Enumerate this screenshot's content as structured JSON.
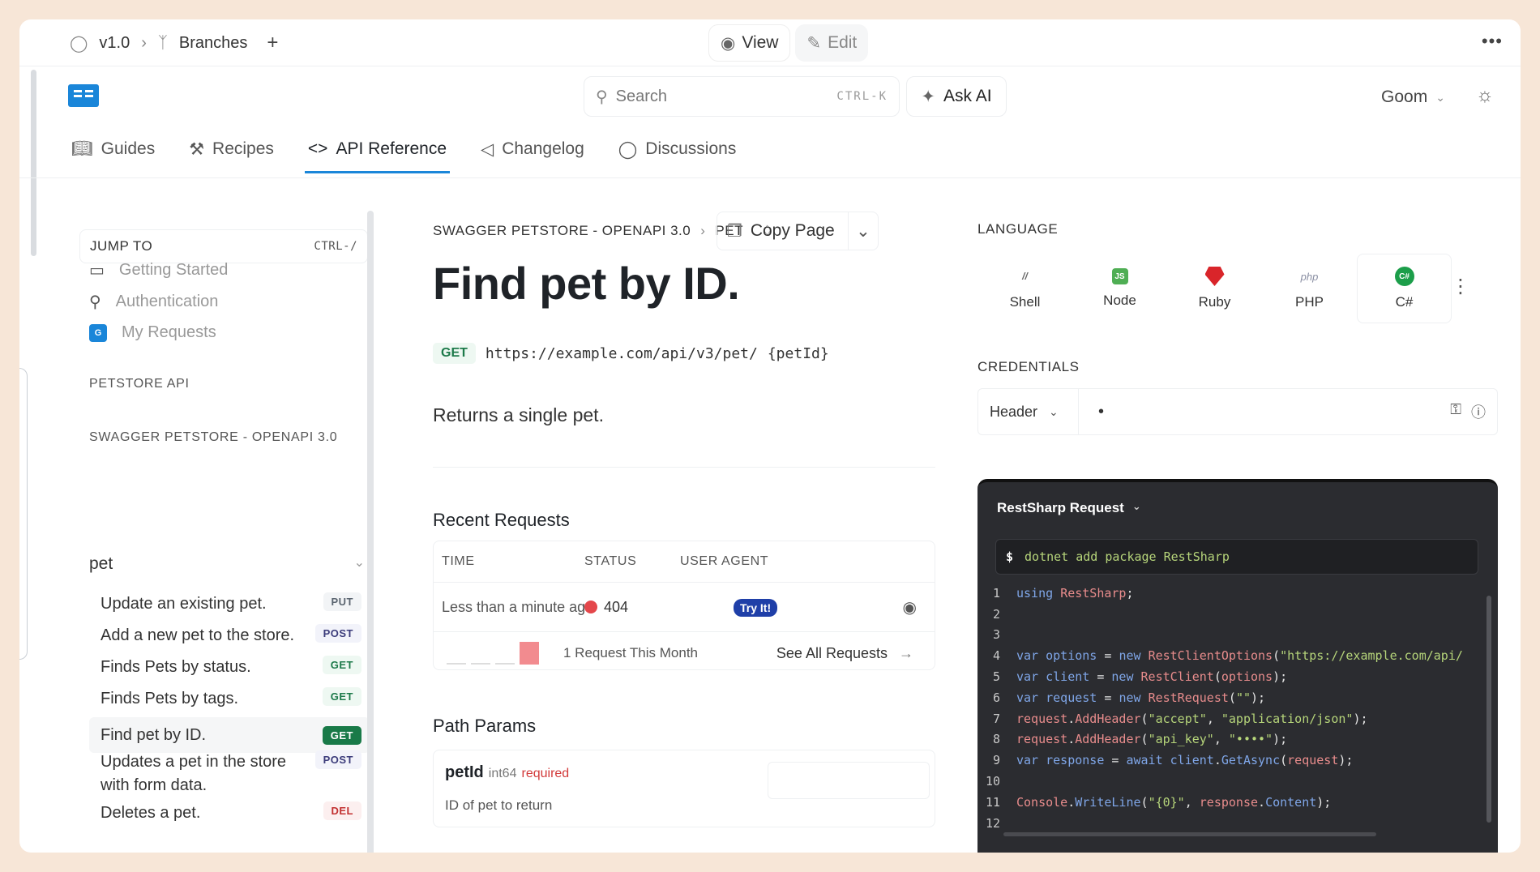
{
  "topbar": {
    "version": "v1.0",
    "branches": "Branches",
    "add": "+",
    "view": "View",
    "edit": "Edit",
    "more": "•••"
  },
  "header": {
    "search_placeholder": "Search",
    "search_kbd": "CTRL-K",
    "ask_ai": "Ask AI",
    "user": "Goom"
  },
  "nav": {
    "tabs": [
      {
        "label": "Guides",
        "icon": "book-icon"
      },
      {
        "label": "Recipes",
        "icon": "flask-icon"
      },
      {
        "label": "API Reference",
        "icon": "code-icon"
      },
      {
        "label": "Changelog",
        "icon": "megaphone-icon"
      },
      {
        "label": "Discussions",
        "icon": "chat-icon"
      }
    ]
  },
  "sidebar": {
    "jump_label": "JUMP TO",
    "jump_kbd": "CTRL-/",
    "top_items": [
      {
        "label": "Getting Started"
      },
      {
        "label": "Authentication"
      },
      {
        "label": "My Requests",
        "badge": "G"
      }
    ],
    "section1": "PETSTORE API",
    "section2": "SWAGGER PETSTORE - OPENAPI 3.0",
    "group": "pet",
    "ops": [
      {
        "label": "Update an existing pet.",
        "method": "PUT"
      },
      {
        "label": "Add a new pet to the store.",
        "method": "POST"
      },
      {
        "label": "Finds Pets by status.",
        "method": "GET"
      },
      {
        "label": "Finds Pets by tags.",
        "method": "GET"
      },
      {
        "label": "Find pet by ID.",
        "method": "GET"
      },
      {
        "label": "Updates a pet in the store with form data.",
        "method": "POST"
      },
      {
        "label": "Deletes a pet.",
        "method": "DEL"
      }
    ]
  },
  "main": {
    "crumb1": "SWAGGER PETSTORE - OPENAPI 3.0",
    "crumb2": "PET",
    "copy_page": "Copy Page",
    "title": "Find pet by ID.",
    "method": "GET",
    "url": "https://example.com/api/v3/pet/",
    "url_param": "{petId}",
    "description": "Returns a single pet.",
    "recent_title": "Recent Requests",
    "cols": {
      "time": "TIME",
      "status": "STATUS",
      "agent": "USER AGENT"
    },
    "row": {
      "time": "Less than a minute ago",
      "status": "404",
      "agent": "Try It!"
    },
    "count": "1 Request This Month",
    "see_all": "See All Requests",
    "path_title": "Path Params",
    "param": {
      "name": "petId",
      "type": "int64",
      "required": "required",
      "desc": "ID of pet to return"
    }
  },
  "right": {
    "language_label": "LANGUAGE",
    "languages": [
      {
        "label": "Shell",
        "glyph": "//"
      },
      {
        "label": "Node",
        "glyph": "JS"
      },
      {
        "label": "Ruby",
        "glyph": ""
      },
      {
        "label": "PHP",
        "glyph": "php"
      },
      {
        "label": "C#",
        "glyph": "C#"
      }
    ],
    "credentials_label": "CREDENTIALS",
    "cred_type": "Header",
    "cred_value": "•",
    "code_title": "RestSharp Request",
    "install_prompt": "$",
    "install_cmd": "dotnet add package RestSharp",
    "lines": [
      "1",
      "2",
      "3",
      "4",
      "5",
      "6",
      "7",
      "8",
      "9",
      "10",
      "11",
      "12"
    ]
  },
  "colors": {
    "accent": "#1a86d9",
    "get": "#197a48",
    "del": "#c23030",
    "code_bg": "#2b2c30"
  }
}
